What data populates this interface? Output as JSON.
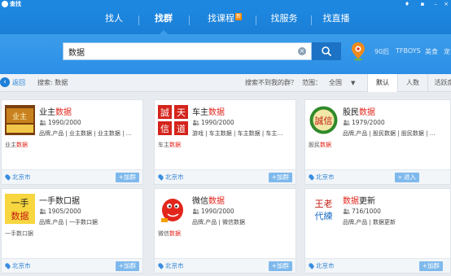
{
  "app": {
    "name": "查找"
  },
  "nav": {
    "tabs": [
      {
        "label": "找人",
        "active": false
      },
      {
        "label": "找群",
        "active": true
      },
      {
        "label": "找课程",
        "active": false,
        "badge": "新"
      },
      {
        "label": "找服务",
        "active": false
      },
      {
        "label": "找直播",
        "active": false
      }
    ]
  },
  "search": {
    "value": "数据",
    "placeholder": "",
    "hot_words": [
      "90后",
      "TFBOYS",
      "美食",
      "宠"
    ]
  },
  "filter": {
    "back_label": "返回",
    "search_label": "搜索: 数据",
    "not_found_text": "搜索不到我的群？",
    "range_label": "范围：",
    "range_value": "全国",
    "sort_options": [
      "默认",
      "人数",
      "活跃度"
    ]
  },
  "colors": {
    "primary": "#1d87e0",
    "highlight": "#e2231a",
    "add_button": "#7fb9ec"
  },
  "groups": [
    {
      "title_pre": "业主",
      "title_hl": "数据",
      "title_post": "",
      "count": "1990/2000",
      "tags": "品牌,产品 | 业主数据 | 业主数据 | …",
      "desc_pre": "业主",
      "desc_hl": "数据",
      "desc_post": "",
      "city": "北京市",
      "action": "+加群",
      "thumb": "yezhu"
    },
    {
      "title_pre": "车主",
      "title_hl": "数据",
      "title_post": "",
      "count": "1990/2000",
      "tags": "游戏 | 车主数据 | 车主数据 | 车主…",
      "desc_pre": "车主",
      "desc_hl": "数据",
      "desc_post": "",
      "city": "北京市",
      "action": "+加群",
      "thumb": "chengxin"
    },
    {
      "title_pre": "股民",
      "title_hl": "数据",
      "title_post": "",
      "count": "1979/2000",
      "tags": "品牌,产品 | 股民数据 | 股民数据 | …",
      "desc_pre": "股民",
      "desc_hl": "数据",
      "desc_post": "",
      "city": "北京市",
      "action": "» 进入",
      "thumb": "chengxin-green"
    },
    {
      "title_pre": "一手数口据",
      "title_hl": "",
      "title_post": "",
      "count": "1905/2000",
      "tags": "品牌,产品 | 一手数口据",
      "desc_pre": "一手数口据",
      "desc_hl": "",
      "desc_post": "",
      "city": "北京市",
      "action": "+加群",
      "thumb": "yishou"
    },
    {
      "title_pre": "微信",
      "title_hl": "数据",
      "title_post": "",
      "count": "1990/2000",
      "tags": "品牌,产品 | 微信数据",
      "desc_pre": "微信",
      "desc_hl": "数据",
      "desc_post": "",
      "city": "北京市",
      "action": "+加群",
      "thumb": "mascot"
    },
    {
      "title_pre": "",
      "title_hl": "数据",
      "title_post": "更新",
      "count": "716/1000",
      "tags": "品牌,产品 | 数据更新",
      "desc_pre": "",
      "desc_hl": "",
      "desc_post": "",
      "city": "北京市",
      "action": "+加群",
      "thumb": "wanglao"
    }
  ]
}
